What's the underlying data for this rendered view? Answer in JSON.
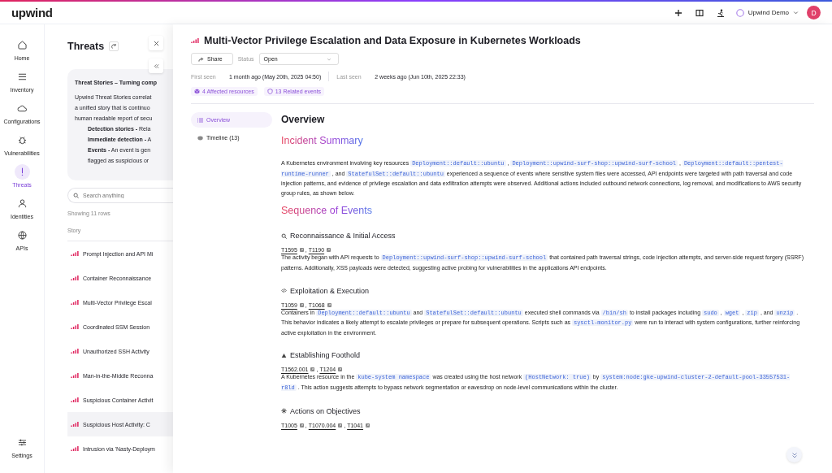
{
  "top_bar": {
    "logo": "upwind",
    "org": "Upwind Demo",
    "avatar": "D"
  },
  "nav": [
    {
      "label": "Home",
      "selected": false
    },
    {
      "label": "Inventory",
      "selected": false
    },
    {
      "label": "Configurations",
      "selected": false
    },
    {
      "label": "Vulnerabilities",
      "selected": false
    },
    {
      "label": "Threats",
      "selected": true
    },
    {
      "label": "Identities",
      "selected": false
    },
    {
      "label": "APIs",
      "selected": false
    }
  ],
  "nav_bottom": {
    "label": "Settings"
  },
  "threats_panel": {
    "title": "Threats",
    "info_card": {
      "title": "Threat Stories – Turning comp",
      "lines": [
        "Upwind Threat Stories correlat",
        "a unified story that is continuo",
        "human readable report of secu"
      ],
      "bullets": [
        "**Detection stories -** Rela",
        "**Immediate detection -** A",
        "**Events -** An event is gen",
        "flagged as suspicious or"
      ]
    },
    "search": {
      "placeholder": "Search anything"
    },
    "row_count": "Showing 11 rows",
    "column": "Story",
    "rows": [
      {
        "title": "Prompt Injection and API Mi",
        "selected": false
      },
      {
        "title": "Container Reconnaissance",
        "selected": false
      },
      {
        "title": "Multi-Vector Privilege Escal",
        "selected": false
      },
      {
        "title": "Coordinated SSM Session",
        "selected": false
      },
      {
        "title": "Unauthorized SSH Activity",
        "selected": false
      },
      {
        "title": "Man-in-the-Middle Reconna",
        "selected": false
      },
      {
        "title": "Suspicious Container Activit",
        "selected": false
      },
      {
        "title": "Suspicious Host Activity: C",
        "selected": true
      },
      {
        "title": "Intrusion via 'Nasty-Deploym",
        "selected": false
      }
    ]
  },
  "drawer": {
    "title": "Multi-Vector Privilege Escalation and Data Exposure in Kubernetes Workloads",
    "share": "Share",
    "status_label": "Status",
    "status": "Open",
    "first_seen_label": "First seen",
    "first_seen": "1 month ago (May 20th, 2025 04:50)",
    "last_seen_label": "Last seen",
    "last_seen": "2 weeks ago (Jun 10th, 2025 22:33)",
    "chips": [
      "4 Affected resources",
      "13 Related events"
    ],
    "tabs": [
      {
        "label": "Overview",
        "selected": true
      },
      {
        "label": "Timeline (13)",
        "selected": false
      }
    ],
    "heading": "Overview",
    "summary_title": "Incident Summary",
    "summary": [
      {
        "kind": "text",
        "text": "A Kubernetes environment involving key resources "
      },
      {
        "kind": "code",
        "text": "Deployment::default::ubuntu"
      },
      {
        "kind": "text",
        "text": " , "
      },
      {
        "kind": "code",
        "text": "Deployment::upwind-surf-shop::upwind-surf-school"
      },
      {
        "kind": "text",
        "text": " , "
      },
      {
        "kind": "code",
        "text": "Deployment::default::pentest-runtime-runner"
      },
      {
        "kind": "text",
        "text": " , and "
      },
      {
        "kind": "code",
        "text": "StatefulSet::default::ubuntu"
      },
      {
        "kind": "text",
        "text": " experienced a sequence of events where sensitive system files were accessed, API endpoints were targeted with path traversal and code injection patterns, and evidence of privilege escalation and data exfiltration attempts were observed. Additional actions included outbound network connections, log removal, and modifications to AWS security group rules, as shown below."
      }
    ],
    "sequence_title": "Sequence of Events",
    "technique_separator": ",",
    "phases": [
      {
        "title": "Reconnaissance & Initial Access",
        "techniques": [
          "T1595",
          "T1190"
        ],
        "text": [
          {
            "kind": "text",
            "text": "The activity began with API requests to "
          },
          {
            "kind": "code",
            "text": "Deployment::upwind-surf-shop::upwind-surf-school"
          },
          {
            "kind": "text",
            "text": " that contained path traversal strings, code injection attempts, and server-side request forgery (SSRF) patterns. Additionally, XSS payloads were detected, suggesting active probing for vulnerabilities in the applications API endpoints."
          }
        ]
      },
      {
        "title": "Exploitation & Execution",
        "techniques": [
          "T1059",
          "T1068"
        ],
        "text": [
          {
            "kind": "text",
            "text": "Containers in "
          },
          {
            "kind": "code",
            "text": "Deployment::default::ubuntu"
          },
          {
            "kind": "text",
            "text": " and "
          },
          {
            "kind": "code",
            "text": "StatefulSet::default::ubuntu"
          },
          {
            "kind": "text",
            "text": " executed shell commands via "
          },
          {
            "kind": "code",
            "text": "/bin/sh"
          },
          {
            "kind": "text",
            "text": " to install packages including "
          },
          {
            "kind": "code",
            "text": "sudo"
          },
          {
            "kind": "text",
            "text": " , "
          },
          {
            "kind": "code",
            "text": "wget"
          },
          {
            "kind": "text",
            "text": " , "
          },
          {
            "kind": "code",
            "text": "zip"
          },
          {
            "kind": "text",
            "text": " , and "
          },
          {
            "kind": "code",
            "text": "unzip"
          },
          {
            "kind": "text",
            "text": " . This behavior indicates a likely attempt to escalate privileges or prepare for subsequent operations. Scripts such as "
          },
          {
            "kind": "code",
            "text": "sysctl-monitor.py"
          },
          {
            "kind": "text",
            "text": " were run to interact with system configurations, further reinforcing active exploitation in the environment."
          }
        ]
      },
      {
        "title": "Establishing Foothold",
        "techniques": [
          "T1562.001",
          "T1204"
        ],
        "text": [
          {
            "kind": "text",
            "text": "A Kubernetes resource in the "
          },
          {
            "kind": "code",
            "text": "kube-system namespace"
          },
          {
            "kind": "text",
            "text": " was created using the host network "
          },
          {
            "kind": "code",
            "text": "(HostNetwork: true)"
          },
          {
            "kind": "text",
            "text": " by "
          },
          {
            "kind": "code",
            "text": "system:node:gke-upwind-cluster-2-default-pool-33557531-r8ld"
          },
          {
            "kind": "text",
            "text": " . This action suggests attempts to bypass network segmentation or eavesdrop on node-level communications within the cluster."
          }
        ]
      },
      {
        "title": "Actions on Objectives",
        "techniques": [
          "T1005",
          "T1070.004",
          "T1041"
        ]
      }
    ]
  }
}
